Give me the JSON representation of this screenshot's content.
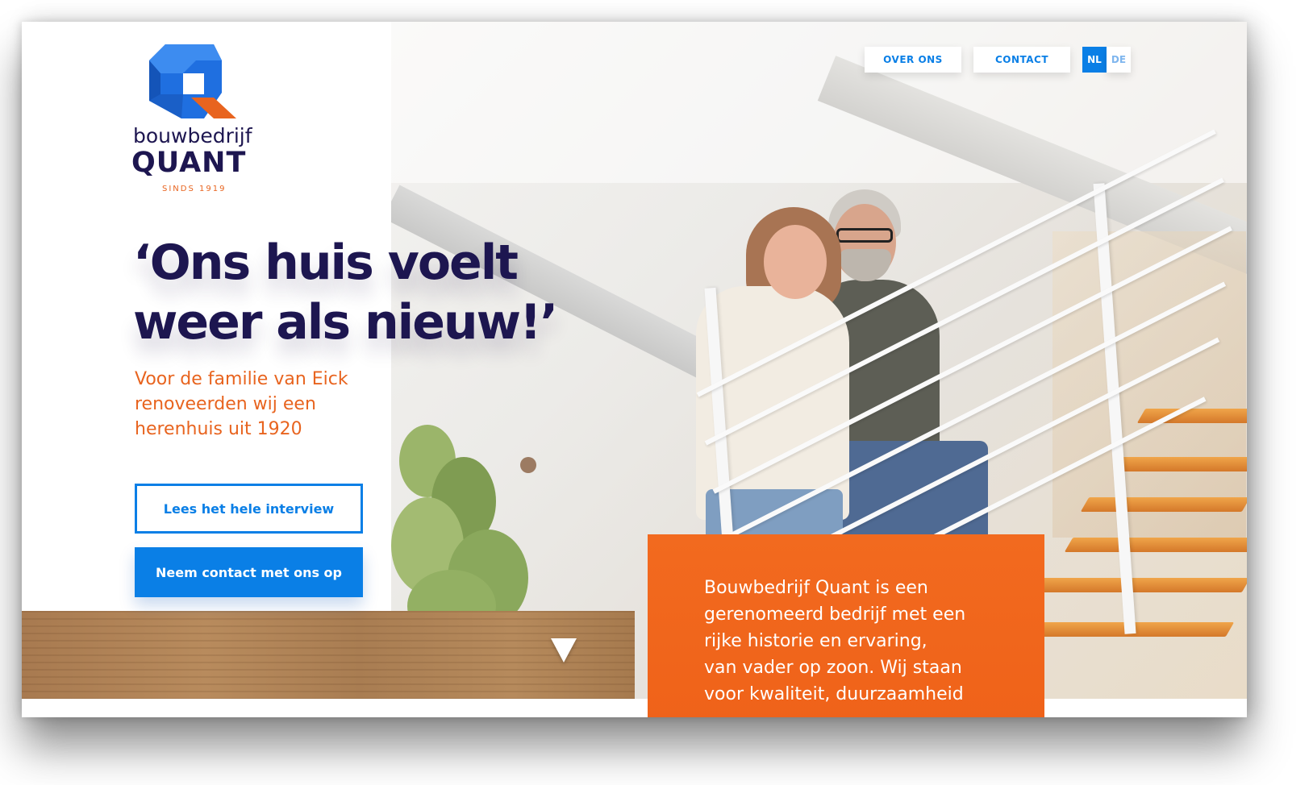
{
  "brand": {
    "name_line1": "bouwbedrijf",
    "name_line2": "QUANT",
    "tagline": "SINDS 1919",
    "colors": {
      "navy": "#1d1650",
      "orange": "#e8641f",
      "blue": "#0a7fe6"
    }
  },
  "nav": {
    "about_label": "OVER ONS",
    "contact_label": "CONTACT",
    "languages": [
      {
        "code": "NL",
        "active": true
      },
      {
        "code": "DE",
        "active": false
      }
    ]
  },
  "hero": {
    "headline_line1": "‘Ons huis voelt",
    "headline_line2": "weer als nieuw!’",
    "subline_line1": "Voor de familie van Eick",
    "subline_line2": "renoveerden wij een",
    "subline_line3": "herenhuis uit 1920",
    "primary_cta": "Lees het hele interview",
    "secondary_cta": "Neem contact met ons op",
    "scroll_icon": "chevron-down-icon"
  },
  "info_box": {
    "line1": "Bouwbedrijf Quant is een",
    "line2": "gerenomeerd bedrijf met een",
    "line3": "rijke historie en ervaring,",
    "line4": "van vader op zoon. Wij staan",
    "line5": "voor kwaliteit, duurzaamheid"
  }
}
